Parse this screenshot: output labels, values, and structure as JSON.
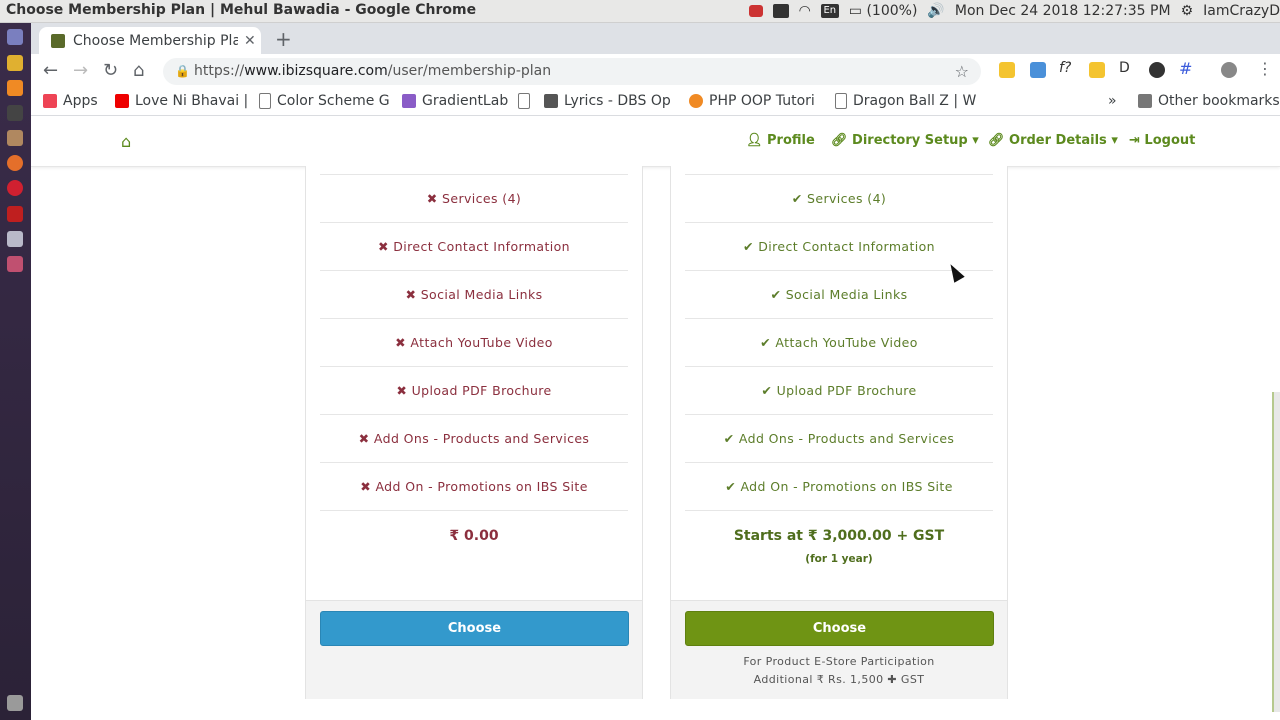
{
  "os": {
    "title": "Choose Membership Plan | Mehul Bawadia - Google Chrome",
    "lang": "En",
    "battery": "(100%)",
    "datetime": "Mon Dec 24 2018 12:27:35 PM",
    "user": "IamCrazyD"
  },
  "browser": {
    "tab_title": "Choose Membership Plan",
    "url_prefix": "https://",
    "url_domain": "www.ibizsquare.com",
    "url_path": "/user/membership-plan",
    "bookmarks": [
      {
        "label": "Apps"
      },
      {
        "label": "Love Ni Bhavai |"
      },
      {
        "label": "Color Scheme G"
      },
      {
        "label": "GradientLab"
      },
      {
        "label": ""
      },
      {
        "label": "Lyrics - DBS Op"
      },
      {
        "label": "PHP OOP Tutori"
      },
      {
        "label": "Dragon Ball Z | W"
      }
    ],
    "other_bookmarks": "Other bookmarks",
    "overflow": "»"
  },
  "navbar": {
    "profile": "Profile",
    "directory": "Directory Setup",
    "orders": "Order Details",
    "logout": "Logout"
  },
  "plans": [
    {
      "features": [
        "Services (4)",
        "Direct Contact Information",
        "Social Media Links",
        "Attach YouTube Video",
        "Upload PDF Brochure",
        "Add Ons - Products and Services",
        "Add On - Promotions on IBS Site"
      ],
      "included": false,
      "price": "₹ 0.00",
      "button": "Choose",
      "button_color": "#3399cc"
    },
    {
      "features": [
        "Services (4)",
        "Direct Contact Information",
        "Social Media Links",
        "Attach YouTube Video",
        "Upload PDF Brochure",
        "Add Ons - Products and Services",
        "Add On - Promotions on IBS Site"
      ],
      "included": true,
      "price": "Starts at ₹ 3,000.00 + GST",
      "price_note": "(for 1 year)",
      "button": "Choose",
      "button_color": "#6f9414",
      "note_line1": "For Product E-Store Participation",
      "note_line2": "Additional ₹ Rs. 1,500 ✚ GST"
    }
  ],
  "colors": {
    "accent_green": "#5c8a1e",
    "cross_red": "#8b2f3e",
    "check_green": "#5c7d2a"
  }
}
